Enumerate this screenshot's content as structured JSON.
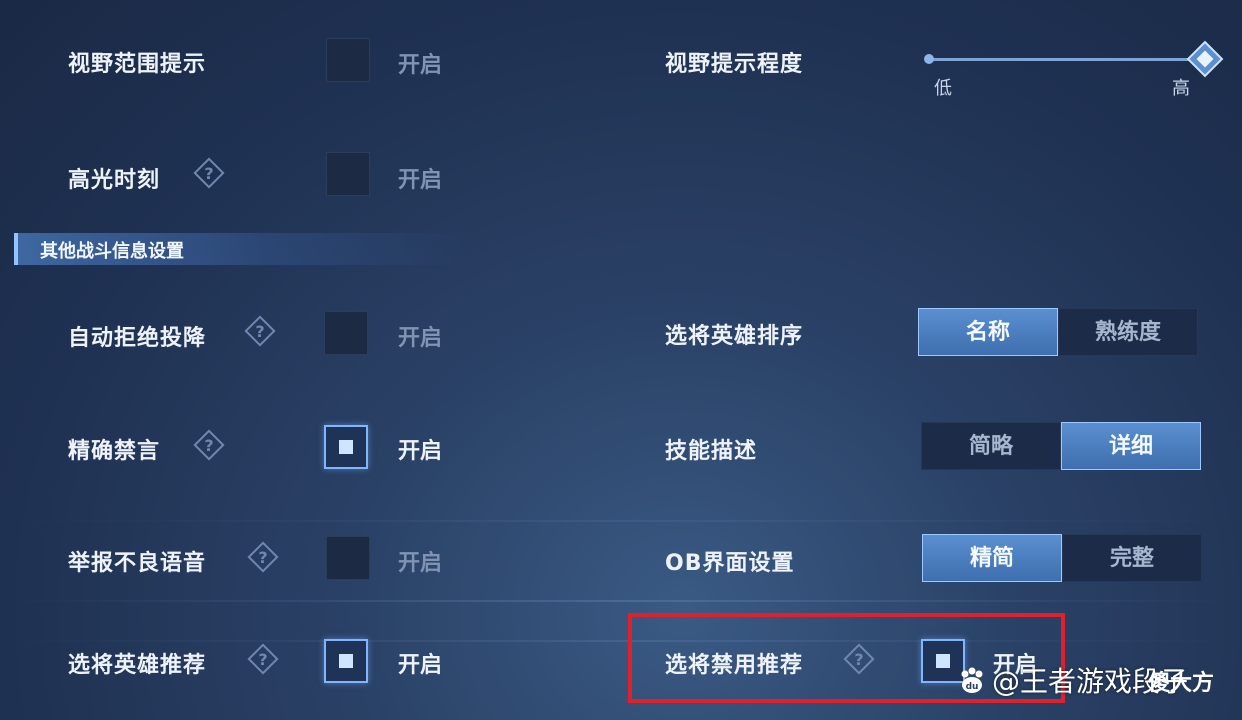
{
  "rows_left": [
    {
      "label": "视野范围提示",
      "help": false,
      "state": "off",
      "value": "开启"
    },
    {
      "label": "高光时刻",
      "help": true,
      "state": "off",
      "value": "开启"
    },
    {
      "label": "自动拒绝投降",
      "help": true,
      "state": "off",
      "value": "开启"
    },
    {
      "label": "精确禁言",
      "help": true,
      "state": "on",
      "value": "开启"
    },
    {
      "label": "举报不良语音",
      "help": true,
      "state": "off",
      "value": "开启"
    },
    {
      "label": "选将英雄推荐",
      "help": true,
      "state": "on",
      "value": "开启"
    }
  ],
  "section_title": "其他战斗信息设置",
  "vision_level": {
    "label": "视野提示程度",
    "low": "低",
    "high": "高",
    "value_fraction": 1.0
  },
  "hero_sort": {
    "label": "选将英雄排序",
    "options": [
      "名称",
      "熟练度"
    ],
    "selected": "名称"
  },
  "skill_desc": {
    "label": "技能描述",
    "options": [
      "简略",
      "详细"
    ],
    "selected": "详细"
  },
  "ob_ui": {
    "label": "OB界面设置",
    "options": [
      "精简",
      "完整"
    ],
    "selected": "精简"
  },
  "ban_recommend": {
    "label": "选将禁用推荐",
    "value": "开启",
    "state": "on"
  },
  "watermark": {
    "text": "@王者游戏段子",
    "sub": "傻大方"
  },
  "colors": {
    "accent": "#7fb6ff",
    "highlight": "#e0202a",
    "background": "#1f3152"
  }
}
